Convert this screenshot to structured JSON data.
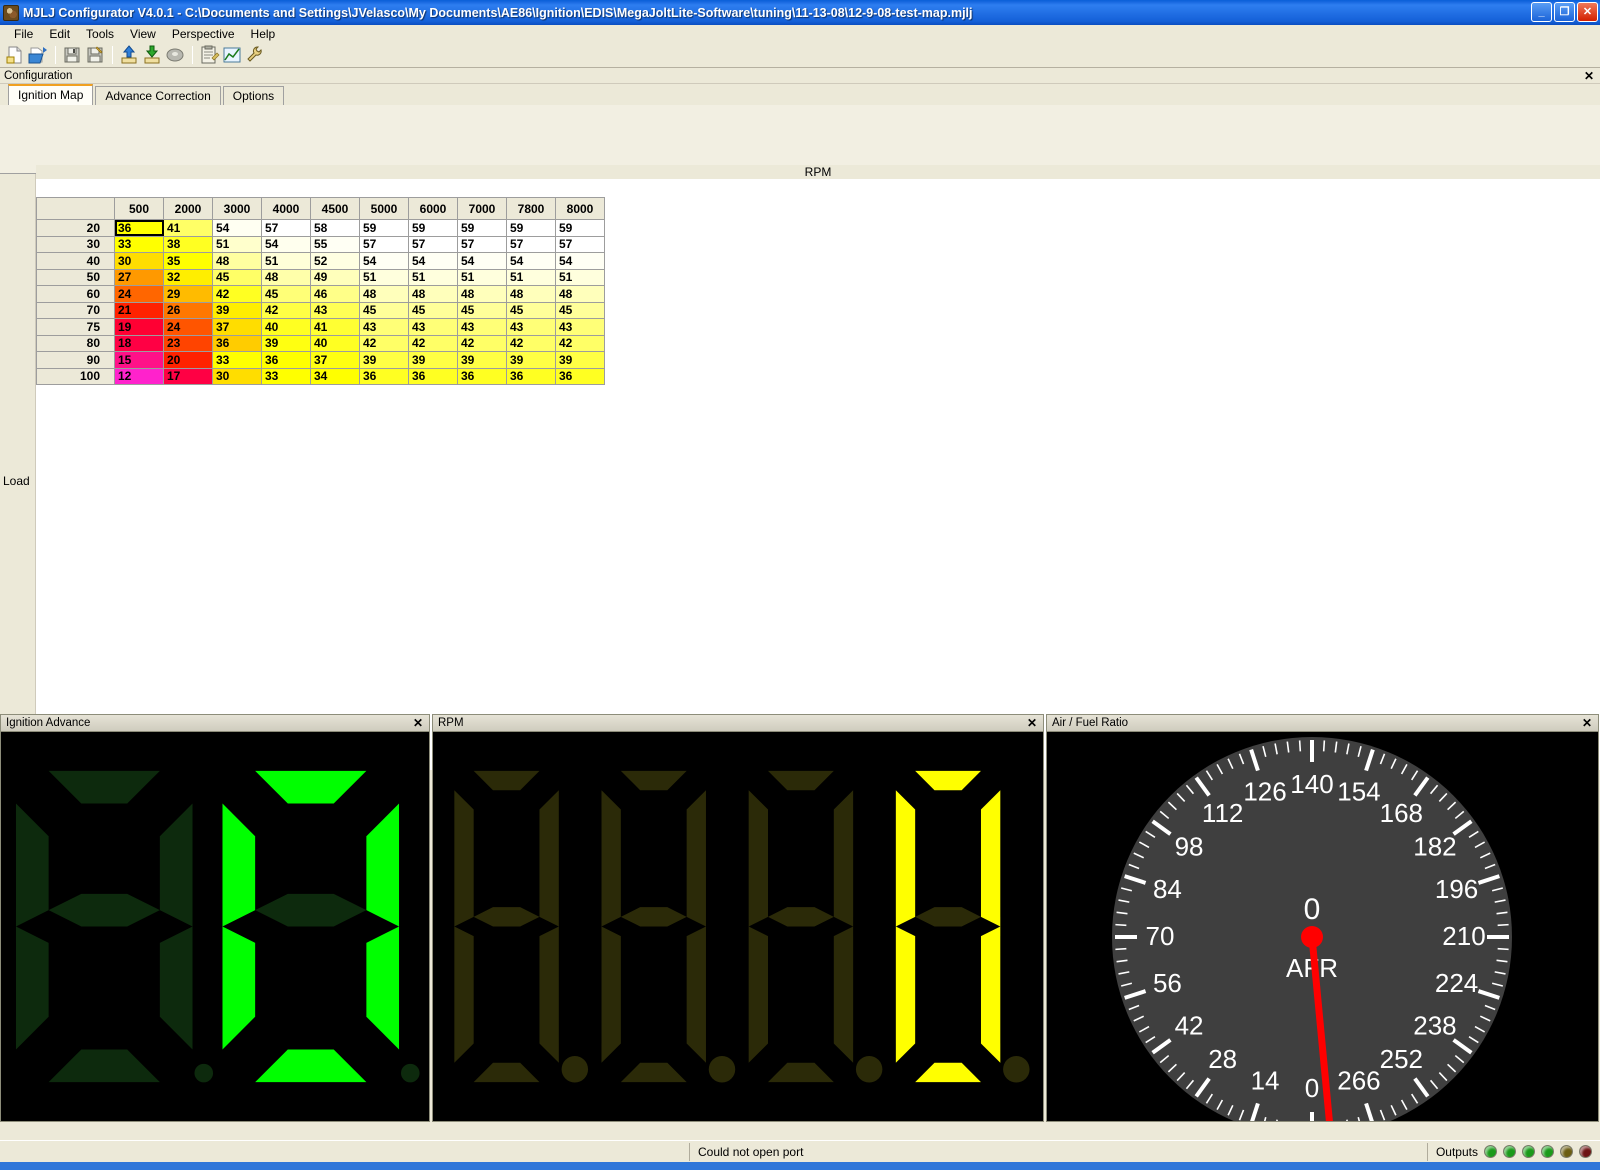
{
  "window": {
    "title": "MJLJ Configurator V4.0.1 - C:\\Documents and Settings\\JVelasco\\My Documents\\AE86\\Ignition\\EDIS\\MegaJoltLite-Software\\tuning\\11-13-08\\12-9-08-test-map.mjlj",
    "minimize_label": "_",
    "maximize_label": "❐",
    "close_label": "✕",
    "app_icon": "app-icon"
  },
  "menu": {
    "items": [
      {
        "label": "File"
      },
      {
        "label": "Edit"
      },
      {
        "label": "Tools"
      },
      {
        "label": "View"
      },
      {
        "label": "Perspective"
      },
      {
        "label": "Help"
      }
    ]
  },
  "toolbar": {
    "buttons": [
      {
        "name": "new-file-icon",
        "glyph": "new"
      },
      {
        "name": "open-folder-icon",
        "glyph": "open"
      },
      {
        "name": "save-icon",
        "glyph": "save"
      },
      {
        "name": "save-as-icon",
        "glyph": "saveas"
      },
      {
        "name": "upload-to-unit-icon",
        "glyph": "upload"
      },
      {
        "name": "download-from-unit-icon",
        "glyph": "download"
      },
      {
        "name": "burn-icon",
        "glyph": "burn"
      },
      {
        "name": "clipboard-icon",
        "glyph": "clipboard"
      },
      {
        "name": "chart-icon",
        "glyph": "chart"
      },
      {
        "name": "wrench-icon",
        "glyph": "wrench"
      }
    ]
  },
  "configuration": {
    "title": "Configuration",
    "close_label": "✕",
    "tabs": [
      {
        "label": "Ignition Map",
        "active": true
      },
      {
        "label": "Advance Correction",
        "active": false
      },
      {
        "label": "Options",
        "active": false
      }
    ]
  },
  "chart_data": {
    "type": "table",
    "title": "Ignition Map",
    "xlabel": "RPM",
    "ylabel": "Load",
    "corner_label": "",
    "categories": [
      "500",
      "2000",
      "3000",
      "4000",
      "4500",
      "5000",
      "6000",
      "7000",
      "7800",
      "8000"
    ],
    "rows": [
      "20",
      "30",
      "40",
      "50",
      "60",
      "70",
      "75",
      "80",
      "90",
      "100"
    ],
    "values": [
      [
        36,
        41,
        54,
        57,
        58,
        59,
        59,
        59,
        59,
        59
      ],
      [
        33,
        38,
        51,
        54,
        55,
        57,
        57,
        57,
        57,
        57
      ],
      [
        30,
        35,
        48,
        51,
        52,
        54,
        54,
        54,
        54,
        54
      ],
      [
        27,
        32,
        45,
        48,
        49,
        51,
        51,
        51,
        51,
        51
      ],
      [
        24,
        29,
        42,
        45,
        46,
        48,
        48,
        48,
        48,
        48
      ],
      [
        21,
        26,
        39,
        42,
        43,
        45,
        45,
        45,
        45,
        45
      ],
      [
        19,
        24,
        37,
        40,
        41,
        43,
        43,
        43,
        43,
        43
      ],
      [
        18,
        23,
        36,
        39,
        40,
        42,
        42,
        42,
        42,
        42
      ],
      [
        15,
        20,
        33,
        36,
        37,
        39,
        39,
        39,
        39,
        39
      ],
      [
        12,
        17,
        30,
        33,
        34,
        36,
        36,
        36,
        36,
        36
      ]
    ],
    "cell_colors": [
      [
        "#ffff00",
        "#ffff66",
        "#fffff2",
        "#ffffff",
        "#ffffff",
        "#ffffff",
        "#ffffff",
        "#ffffff",
        "#ffffff",
        "#ffffff"
      ],
      [
        "#ffff00",
        "#ffff22",
        "#ffffcc",
        "#ffffee",
        "#fffff4",
        "#ffffff",
        "#ffffff",
        "#ffffff",
        "#ffffff",
        "#ffffff"
      ],
      [
        "#ffdd00",
        "#ffff00",
        "#ffffa0",
        "#ffffd8",
        "#ffffe2",
        "#fffff4",
        "#fffff4",
        "#fffff4",
        "#fffff4",
        "#fffff4"
      ],
      [
        "#ff9900",
        "#ffee00",
        "#ffff66",
        "#ffffaa",
        "#ffffbb",
        "#ffffdd",
        "#ffffdd",
        "#ffffdd",
        "#ffffdd",
        "#ffffdd"
      ],
      [
        "#ff6600",
        "#ffbb00",
        "#ffff22",
        "#ffff77",
        "#ffff88",
        "#ffffbb",
        "#ffffbb",
        "#ffffbb",
        "#ffffbb",
        "#ffffbb"
      ],
      [
        "#ff2200",
        "#ff7700",
        "#ffee00",
        "#ffff44",
        "#ffff55",
        "#ffff99",
        "#ffff99",
        "#ffff99",
        "#ffff99",
        "#ffff99"
      ],
      [
        "#ff0033",
        "#ff5500",
        "#ffdd00",
        "#ffff22",
        "#ffff33",
        "#ffff77",
        "#ffff77",
        "#ffff77",
        "#ffff77",
        "#ffff77"
      ],
      [
        "#ff0044",
        "#ff4400",
        "#ffcc00",
        "#ffff11",
        "#ffff22",
        "#ffff66",
        "#ffff66",
        "#ffff66",
        "#ffff66",
        "#ffff66"
      ],
      [
        "#ff1188",
        "#ff2200",
        "#ffff00",
        "#ffff00",
        "#ffff11",
        "#ffff44",
        "#ffff44",
        "#ffff44",
        "#ffff44",
        "#ffff44"
      ],
      [
        "#ff22cc",
        "#ff0044",
        "#ffdd00",
        "#ffff00",
        "#ffff00",
        "#ffff22",
        "#ffff22",
        "#ffff22",
        "#ffff22",
        "#ffff22"
      ]
    ],
    "selected_cell": {
      "row": 0,
      "col": 0,
      "value": 36
    }
  },
  "panels": {
    "ignition_advance": {
      "title": "Ignition Advance",
      "close_label": "✕",
      "value": "0",
      "digits": 2,
      "color_on": "#00ff00",
      "color_off": "#0d2a0d",
      "background": "#000000"
    },
    "rpm": {
      "title": "RPM",
      "close_label": "✕",
      "value": "0",
      "digits": 4,
      "color_on": "#ffff00",
      "color_off": "#2b2a08",
      "background": "#000000"
    },
    "afr": {
      "title": "Air / Fuel Ratio",
      "close_label": "✕",
      "center_value": "0",
      "unit_label": "AFR",
      "needle_value": 0,
      "needle_color": "#ff0000",
      "dial_color": "#3f3f3f",
      "tick_color": "#ffffff",
      "ticks": [
        "0",
        "14",
        "28",
        "42",
        "56",
        "70",
        "84",
        "98",
        "112",
        "126",
        "140",
        "154",
        "168",
        "182",
        "196",
        "210",
        "224",
        "238",
        "252",
        "266"
      ],
      "min": 0,
      "max": 280
    }
  },
  "statusbar": {
    "left_text": "",
    "message": "Could not open port",
    "outputs_label": "Outputs",
    "leds": [
      {
        "name": "output-led-1",
        "color": "#1a9a1a",
        "state": "on"
      },
      {
        "name": "output-led-2",
        "color": "#1a9a1a",
        "state": "on"
      },
      {
        "name": "output-led-3",
        "color": "#1a9a1a",
        "state": "on"
      },
      {
        "name": "output-led-4",
        "color": "#1a9a1a",
        "state": "on"
      },
      {
        "name": "output-led-5",
        "color": "#6b5d12",
        "state": "off"
      },
      {
        "name": "output-led-6",
        "color": "#6e1414",
        "state": "off"
      }
    ]
  }
}
